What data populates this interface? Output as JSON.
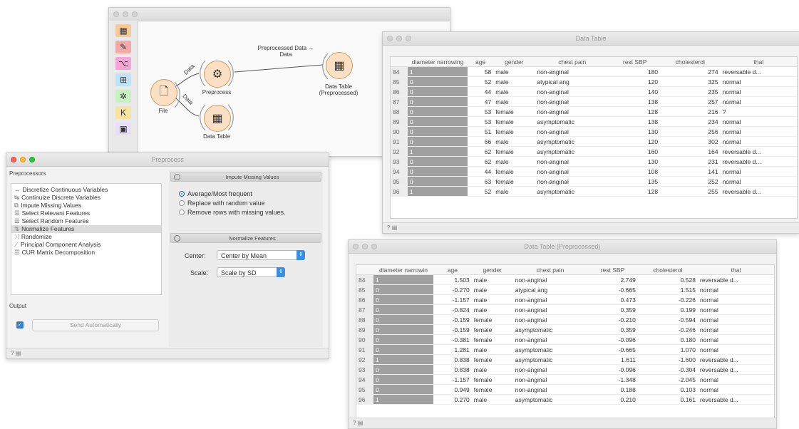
{
  "canvas": {
    "nodes": {
      "file": "File",
      "preprocess": "Preprocess",
      "data_table": "Data Table",
      "data_table_pre": "Data Table\n(Preprocessed)"
    },
    "links": {
      "file_preprocess": "Data",
      "file_table": "Data",
      "pre_table": "Preprocessed Data →\nData"
    }
  },
  "data_table": {
    "title": "Data Table",
    "columns": [
      "",
      "diameter narrowing",
      "age",
      "gender",
      "chest pain",
      "rest SBP",
      "cholesterol",
      "thal"
    ],
    "rows": [
      [
        "84",
        "1",
        "58",
        "male",
        "non-anginal",
        "180",
        "274",
        "reversable d..."
      ],
      [
        "85",
        "0",
        "52",
        "male",
        "atypical ang",
        "120",
        "325",
        "normal"
      ],
      [
        "86",
        "0",
        "44",
        "male",
        "non-anginal",
        "140",
        "235",
        "normal"
      ],
      [
        "87",
        "0",
        "47",
        "male",
        "non-anginal",
        "138",
        "257",
        "normal"
      ],
      [
        "88",
        "0",
        "53",
        "female",
        "non-anginal",
        "128",
        "216",
        "?"
      ],
      [
        "89",
        "0",
        "53",
        "female",
        "asymptomatic",
        "138",
        "234",
        "normal"
      ],
      [
        "90",
        "0",
        "51",
        "female",
        "non-anginal",
        "130",
        "256",
        "normal"
      ],
      [
        "91",
        "0",
        "66",
        "male",
        "asymptomatic",
        "120",
        "302",
        "normal"
      ],
      [
        "92",
        "1",
        "62",
        "female",
        "asymptomatic",
        "160",
        "164",
        "reversable d..."
      ],
      [
        "93",
        "0",
        "62",
        "male",
        "non-anginal",
        "130",
        "231",
        "reversable d..."
      ],
      [
        "94",
        "0",
        "44",
        "female",
        "non-anginal",
        "108",
        "141",
        "normal"
      ],
      [
        "95",
        "0",
        "63",
        "female",
        "non-anginal",
        "135",
        "252",
        "normal"
      ],
      [
        "96",
        "1",
        "52",
        "male",
        "asymptomatic",
        "128",
        "255",
        "reversable d..."
      ]
    ]
  },
  "data_table_pre": {
    "title": "Data Table (Preprocessed)",
    "columns": [
      "",
      "diameter narrowin",
      "age",
      "gender",
      "chest pain",
      "rest SBP",
      "cholesterol",
      "thal"
    ],
    "rows": [
      [
        "84",
        "1",
        "1.503",
        "male",
        "non-anginal",
        "2.749",
        "0.528",
        "reversable d..."
      ],
      [
        "85",
        "0",
        "-0.270",
        "male",
        "atypical ang",
        "-0.665",
        "1.515",
        "normal"
      ],
      [
        "86",
        "0",
        "-1.157",
        "male",
        "non-anginal",
        "0.473",
        "-0.226",
        "normal"
      ],
      [
        "87",
        "0",
        "-0.824",
        "male",
        "non-anginal",
        "0.359",
        "0.199",
        "normal"
      ],
      [
        "88",
        "0",
        "-0.159",
        "female",
        "non-anginal",
        "-0.210",
        "-0.594",
        "normal"
      ],
      [
        "89",
        "0",
        "-0.159",
        "female",
        "asymptomatic",
        "0.359",
        "-0.246",
        "normal"
      ],
      [
        "90",
        "0",
        "-0.381",
        "female",
        "non-anginal",
        "-0.096",
        "0.180",
        "normal"
      ],
      [
        "91",
        "0",
        "1.281",
        "male",
        "asymptomatic",
        "-0.665",
        "1.070",
        "normal"
      ],
      [
        "92",
        "1",
        "0.838",
        "female",
        "asymptomatic",
        "1.611",
        "-1.600",
        "reversable d..."
      ],
      [
        "93",
        "0",
        "0.838",
        "male",
        "non-anginal",
        "-0.096",
        "-0.304",
        "reversable d..."
      ],
      [
        "94",
        "0",
        "-1.157",
        "female",
        "non-anginal",
        "-1.348",
        "-2.045",
        "normal"
      ],
      [
        "95",
        "0",
        "0.949",
        "female",
        "non-anginal",
        "0.188",
        "0.103",
        "normal"
      ],
      [
        "96",
        "1",
        "0.270",
        "male",
        "asymptomatic",
        "0.210",
        "0.161",
        "reversable d..."
      ]
    ]
  },
  "preprocess": {
    "title": "Preprocess",
    "list_header": "Preprocessors",
    "items": [
      "Discretize Continuous Variables",
      "Continuize Discrete Variables",
      "Impute Missing Values",
      "Select Relevant Features",
      "Select Random Features",
      "Normalize Features",
      "Randomize",
      "Principal Component Analysis",
      "CUR Matrix Decomposition"
    ],
    "selected_index": 5,
    "output_label": "Output",
    "send_auto": "Send Automatically",
    "impute": {
      "title": "Impute Missing Values",
      "options": [
        "Average/Most frequent",
        "Replace with random value",
        "Remove rows with missing values."
      ],
      "selected": 0
    },
    "normalize": {
      "title": "Normalize Features",
      "center_label": "Center:",
      "center_value": "Center by Mean",
      "scale_label": "Scale:",
      "scale_value": "Scale by SD"
    }
  },
  "colors": {
    "node_fill": "#fbe0c4",
    "node_border": "#d19b62",
    "accent": "#2f7fe0",
    "bar": "#a0a0a0"
  }
}
